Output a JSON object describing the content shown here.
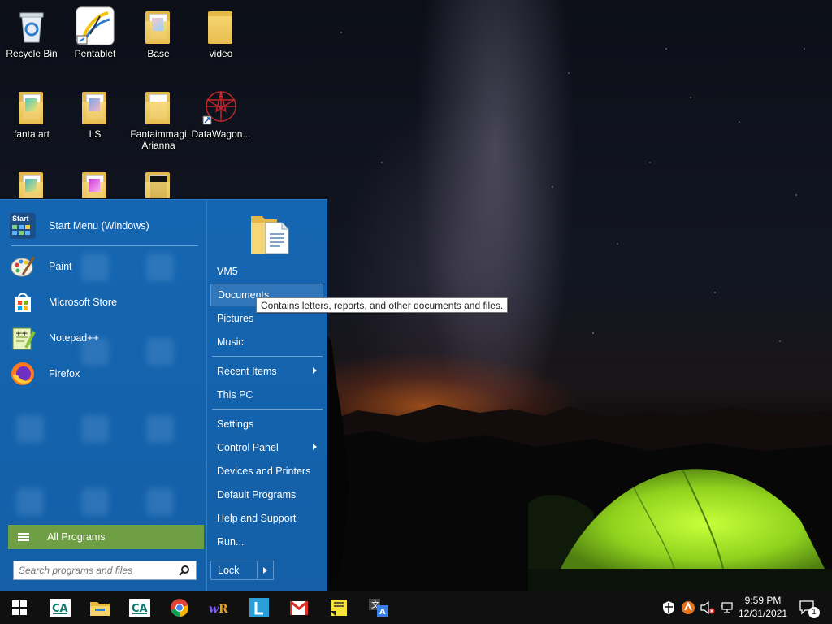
{
  "desktop": {
    "icons": [
      {
        "label": "Recycle Bin"
      },
      {
        "label": "Pentablet"
      },
      {
        "label": "Base"
      },
      {
        "label": "video"
      },
      {
        "label": "fanta art"
      },
      {
        "label": "LS"
      },
      {
        "label": "Fantaimmagi Arianna"
      },
      {
        "label": "DataWagon..."
      }
    ]
  },
  "start_menu": {
    "pinned": [
      {
        "label": "Start Menu (Windows)",
        "icon": "start-menu-icon",
        "icon_text": "Start"
      },
      {
        "label": "Paint",
        "icon": "paint-icon"
      },
      {
        "label": "Microsoft Store",
        "icon": "store-icon"
      },
      {
        "label": "Notepad++",
        "icon": "notepadpp-icon"
      },
      {
        "label": "Firefox",
        "icon": "firefox-icon"
      }
    ],
    "all_programs": "All Programs",
    "search_placeholder": "Search programs and files",
    "right": {
      "user": "VM5",
      "documents": "Documents",
      "pictures": "Pictures",
      "music": "Music",
      "recent_items": "Recent Items",
      "this_pc": "This PC",
      "settings": "Settings",
      "control_panel": "Control Panel",
      "devices_printers": "Devices and Printers",
      "default_programs": "Default Programs",
      "help_support": "Help and Support",
      "run": "Run...",
      "lock": "Lock"
    },
    "tooltip": "Contains letters, reports, and other documents and files."
  },
  "taskbar": {
    "apps": [
      "windows-start-icon",
      "credit-agricole-icon",
      "file-explorer-icon",
      "credit-agricole-icon",
      "chrome-icon",
      "winrar-icon",
      "l-app-icon",
      "gmail-icon",
      "sticky-notes-icon",
      "translate-icon"
    ],
    "time": "9:59 PM",
    "date": "12/31/2021",
    "notification_count": "1"
  },
  "colors": {
    "start_menu_bg": "#1566b2",
    "all_programs_bg": "#6f9f45",
    "taskbar_bg": "#101010"
  }
}
